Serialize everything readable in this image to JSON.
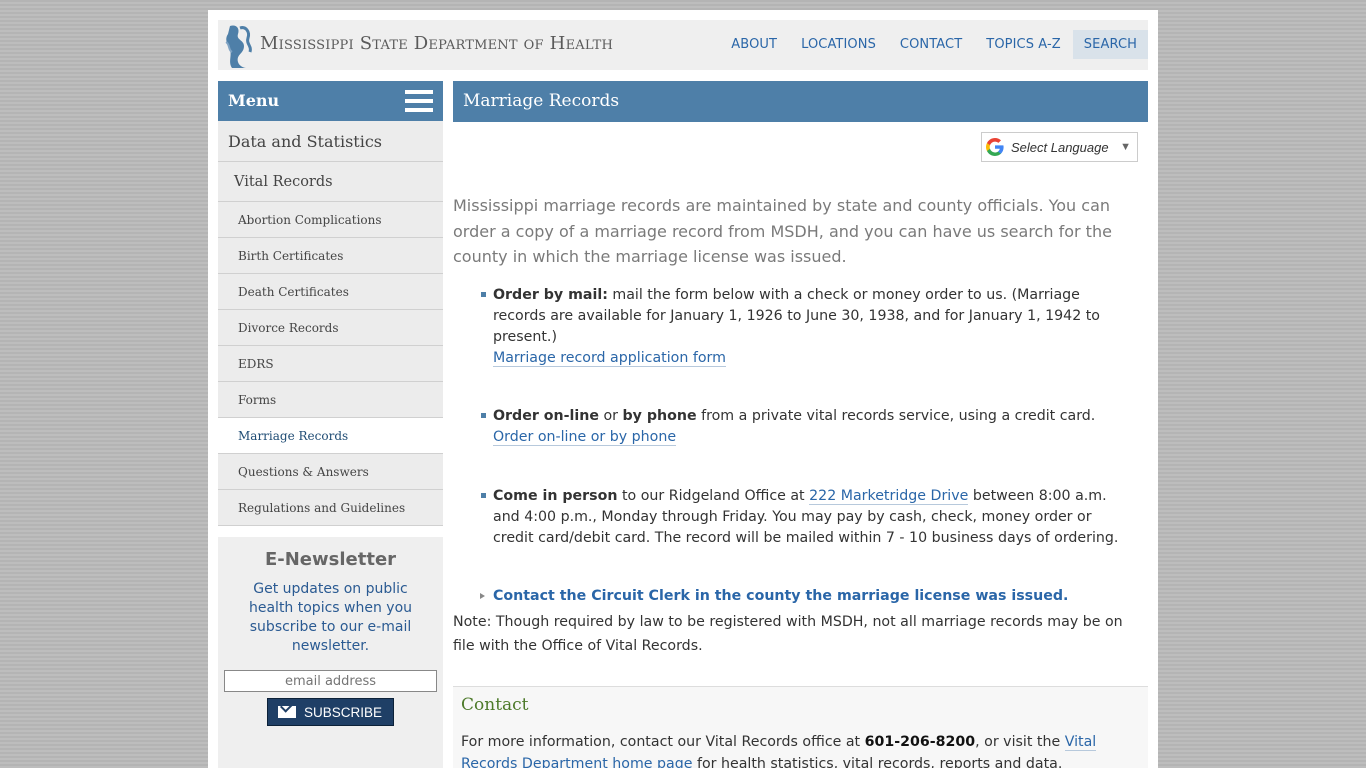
{
  "header": {
    "site_title": "Mississippi State Department of Health",
    "nav": [
      {
        "label": "ABOUT"
      },
      {
        "label": "LOCATIONS"
      },
      {
        "label": "CONTACT"
      },
      {
        "label": "TOPICS A-Z"
      },
      {
        "label": "SEARCH"
      }
    ]
  },
  "sidebar": {
    "menu_label": "Menu",
    "section": "Data and Statistics",
    "subsection": "Vital Records",
    "items": [
      {
        "label": "Abortion Complications"
      },
      {
        "label": "Birth Certificates"
      },
      {
        "label": "Death Certificates"
      },
      {
        "label": "Divorce Records"
      },
      {
        "label": "EDRS"
      },
      {
        "label": "Forms"
      },
      {
        "label": "Marriage Records"
      },
      {
        "label": "Questions & Answers"
      },
      {
        "label": "Regulations and Guidelines"
      }
    ],
    "active_item": "Marriage Records"
  },
  "newsletter": {
    "title": "E-Newsletter",
    "text": "Get updates on public health topics when you subscribe to our e-mail newsletter.",
    "email_placeholder": "email address",
    "subscribe_label": "SUBSCRIBE"
  },
  "main": {
    "title": "Marriage Records",
    "language_select": "Select Language",
    "intro": "Mississippi marriage records are maintained by state and county officials. You can order a copy of a marriage record from MSDH, and you can have us search for the county in which the marriage license was issued.",
    "bullets": {
      "mail_bold": "Order by mail:",
      "mail_text": " mail the form below with a check or money order to us. (Marriage records are available for January 1, 1926 to June 30, 1938, and for January 1, 1942 to present.)",
      "mail_link": "Marriage record application form",
      "online_bold1": "Order on-line",
      "online_or": " or ",
      "online_bold2": "by phone",
      "online_text": " from a private vital records service, using a credit card.",
      "online_link": "Order on-line or by phone",
      "person_bold": "Come in person",
      "person_text1": " to our Ridgeland Office at ",
      "person_link": "222 Marketridge Drive",
      "person_text2": " between 8:00 a.m. and 4:00 p.m., Monday through Friday. You may pay by cash, check, money order or credit card/debit card. The record will be mailed within 7 - 10 business days of ordering.",
      "clerk_link": "Contact the Circuit Clerk in the county the marriage license was issued."
    },
    "note": "Note: Though required by law to be registered with MSDH, not all marriage records may be on file with the Office of Vital Records.",
    "contact": {
      "title": "Contact",
      "text1": "For more information, contact our Vital Records office at ",
      "phone": "601-206-8200",
      "text2": ", or visit the ",
      "link": "Vital Records Department home page",
      "text3": " for health statistics, vital records, reports and data."
    }
  },
  "colors": {
    "accent_blue": "#4e7fa8",
    "link_blue": "#2a66a8",
    "contact_green": "#4d7a2a",
    "button_navy": "#1f3f66"
  }
}
